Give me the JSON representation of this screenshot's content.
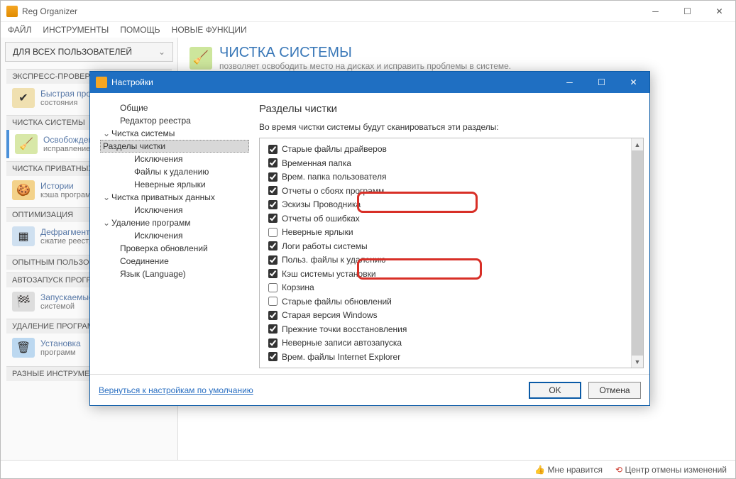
{
  "app": {
    "title": "Reg Organizer"
  },
  "menubar": [
    "ФАЙЛ",
    "ИНСТРУМЕНТЫ",
    "ПОМОЩЬ",
    "НОВЫЕ ФУНКЦИИ"
  ],
  "user_scope": "ДЛЯ ВСЕХ ПОЛЬЗОВАТЕЛЕЙ",
  "left_headers": {
    "express": "ЭКСПРЕСС-ПРОВЕРКА",
    "clean": "ЧИСТКА СИСТЕМЫ",
    "privacy": "ЧИСТКА ПРИВАТНЫХ ДАННЫХ",
    "optim": "ОПТИМИЗАЦИЯ",
    "expert": "ОПЫТНЫМ ПОЛЬЗОВАТЕЛЯМ",
    "autorun": "АВТОЗАПУСК ПРОГРАММ",
    "uninstall": "УДАЛЕНИЕ ПРОГРАММ",
    "misc": "РАЗНЫЕ ИНСТРУМЕНТЫ"
  },
  "left_items": {
    "express": {
      "l1": "Быстрая проверка",
      "l2": "состояния"
    },
    "clean": {
      "l1": "Освобождение",
      "l2": "исправление"
    },
    "privacy": {
      "l1": "Истории",
      "l2": "кэша программ"
    },
    "optim": {
      "l1": "Дефрагментация",
      "l2": "сжатие реестра"
    },
    "autorun": {
      "l1": "Запускаемые",
      "l2": "системой"
    },
    "uninstall": {
      "l1": "Установка",
      "l2": "программ"
    }
  },
  "page": {
    "title": "ЧИСТКА СИСТЕМЫ",
    "subtitle": "позволяет освободить место на дисках и исправить проблемы в системе."
  },
  "statusbar": {
    "like": "Мне нравится",
    "undo": "Центр отмены изменений"
  },
  "dialog": {
    "title": "Настройки",
    "tree": {
      "general": "Общие",
      "regedit": "Редактор реестра",
      "sysclean": "Чистка системы",
      "sections": "Разделы чистки",
      "exclusions": "Исключения",
      "files_del": "Файлы к удалению",
      "bad_shortcuts": "Неверные ярлыки",
      "privclean": "Чистка приватных данных",
      "priv_excl": "Исключения",
      "uninst": "Удаление программ",
      "uninst_excl": "Исключения",
      "updates": "Проверка обновлений",
      "connection": "Соединение",
      "language": "Язык (Language)"
    },
    "right_title": "Разделы чистки",
    "right_desc": "Во время чистки системы будут сканироваться эти разделы:",
    "items": [
      {
        "label": "Старые файлы драйверов",
        "checked": true
      },
      {
        "label": "Временная папка",
        "checked": true
      },
      {
        "label": "Врем. папка пользователя",
        "checked": true
      },
      {
        "label": "Отчеты о сбоях программ",
        "checked": true
      },
      {
        "label": "Эскизы Проводника",
        "checked": true
      },
      {
        "label": "Отчеты об ошибках",
        "checked": true
      },
      {
        "label": "Неверные ярлыки",
        "checked": false
      },
      {
        "label": "Логи работы системы",
        "checked": true
      },
      {
        "label": "Польз. файлы к удалению",
        "checked": true
      },
      {
        "label": "Кэш системы установки",
        "checked": true
      },
      {
        "label": "Корзина",
        "checked": false
      },
      {
        "label": "Старые файлы обновлений",
        "checked": false
      },
      {
        "label": "Старая версия Windows",
        "checked": true
      },
      {
        "label": "Прежние точки восстановления",
        "checked": true
      },
      {
        "label": "Неверные записи автозапуска",
        "checked": true
      },
      {
        "label": "Врем. файлы Internet Explorer",
        "checked": true
      }
    ],
    "restore_defaults": "Вернуться к настройкам по умолчанию",
    "ok": "OK",
    "cancel": "Отмена"
  }
}
